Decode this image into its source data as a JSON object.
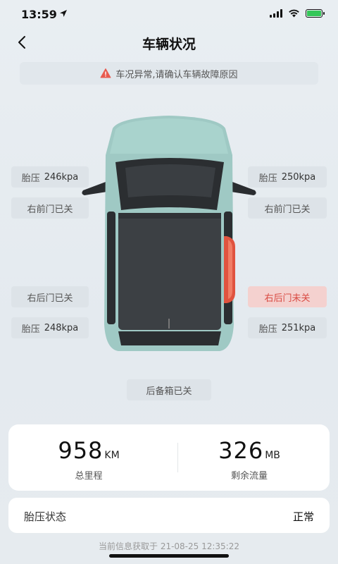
{
  "status_bar": {
    "time": "13:59",
    "location_icon": "location-arrow-icon",
    "signal_icon": "cellular-signal-icon",
    "wifi_icon": "wifi-icon",
    "battery_icon": "battery-charging-icon",
    "battery_color": "#34c759"
  },
  "nav": {
    "title": "车辆状况",
    "back_icon": "chevron-left-icon"
  },
  "alert": {
    "icon": "warning-triangle-icon",
    "icon_color": "#e85a4f",
    "text": "车况异常,请确认车辆故障原因"
  },
  "tires": {
    "label": "胎压",
    "front_left": "246kpa",
    "front_right": "250kpa",
    "rear_left": "248kpa",
    "rear_right": "251kpa"
  },
  "doors": {
    "front_left": "右前门已关",
    "front_right": "右前门已关",
    "rear_left": "右后门已关",
    "rear_right": "右后门未关",
    "trunk": "后备箱已关"
  },
  "colors": {
    "alert_text": "#d94a42",
    "alert_bg": "#f4d1cf",
    "car_body": "#9fc9c4"
  },
  "stats": {
    "mileage_value": "958",
    "mileage_unit": "KM",
    "mileage_label": "总里程",
    "data_value": "326",
    "data_unit": "MB",
    "data_label": "剩余流量"
  },
  "tire_status": {
    "label": "胎压状态",
    "value": "正常"
  },
  "footer": {
    "timestamp": "当前信息获取于  21-08-25 12:35:22"
  }
}
